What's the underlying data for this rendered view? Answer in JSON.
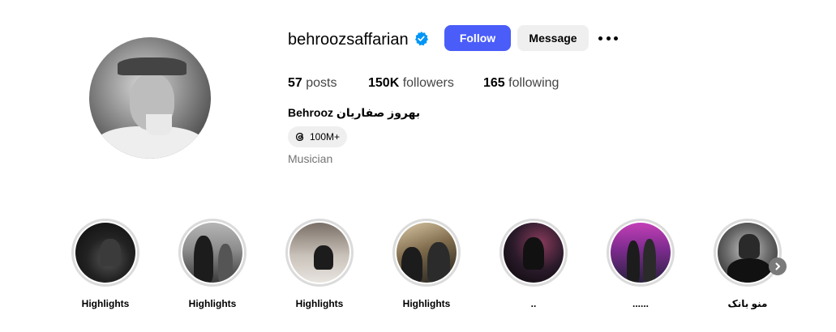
{
  "profile": {
    "username": "behroozsaffarian",
    "verified": true,
    "full_name": "Behrooz بهروز صفاریان",
    "threads_count": "100M+",
    "category": "Musician"
  },
  "buttons": {
    "follow": "Follow",
    "message": "Message"
  },
  "stats": {
    "posts_count": "57",
    "posts_label": "posts",
    "followers_count": "150K",
    "followers_label": "followers",
    "following_count": "165",
    "following_label": "following"
  },
  "highlights": [
    {
      "label": "Highlights"
    },
    {
      "label": "Highlights"
    },
    {
      "label": "Highlights"
    },
    {
      "label": "Highlights"
    },
    {
      "label": ".."
    },
    {
      "label": "......"
    },
    {
      "label": "منو بانک"
    }
  ],
  "colors": {
    "follow_button": "#4a5df9",
    "verified_badge": "#0095f6",
    "secondary_text": "#737373"
  },
  "icons": [
    "verified-badge-icon",
    "more-options-icon",
    "threads-icon",
    "chevron-right-icon"
  ]
}
